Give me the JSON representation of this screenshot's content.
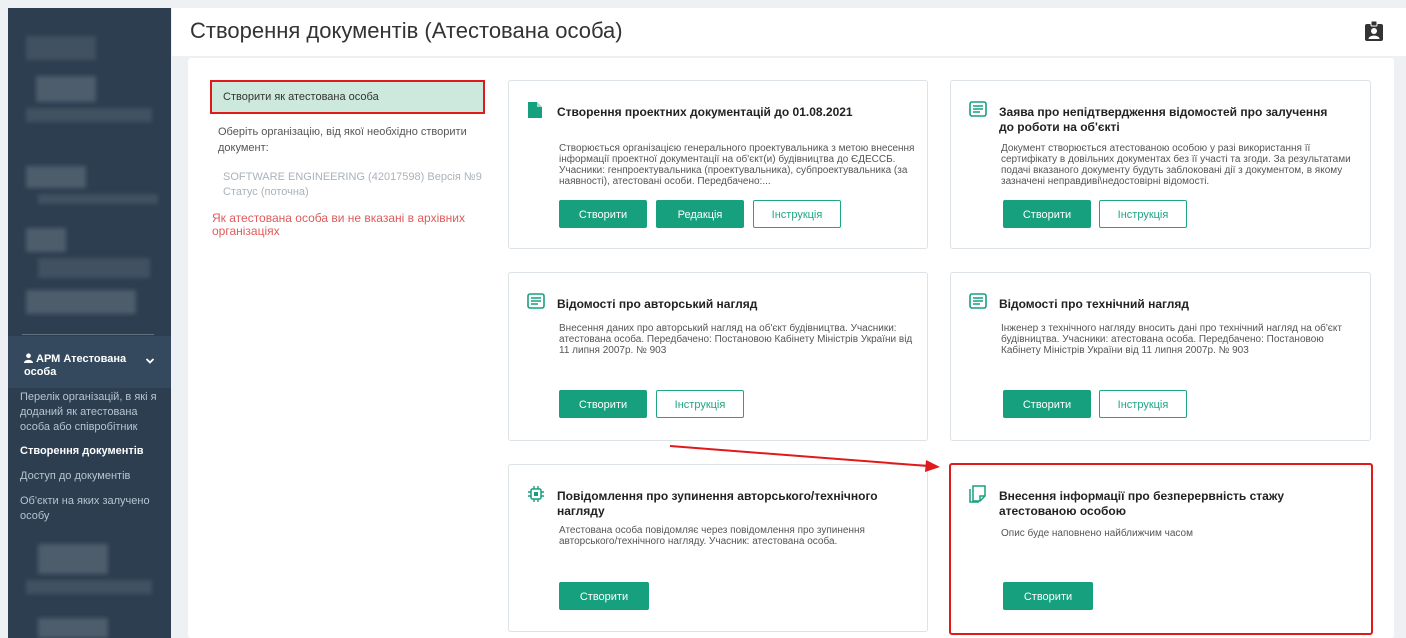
{
  "sidebar": {
    "arm": {
      "label": "АРМ Атестована особа"
    },
    "links": [
      {
        "label": "Перелік організацій, в які я доданий як атестована особа або співробітник",
        "active": false
      },
      {
        "label": "Створення документів",
        "active": true
      },
      {
        "label": "Доступ до документів",
        "active": false
      },
      {
        "label": "Об'єкти на яких залучено особу",
        "active": false
      }
    ]
  },
  "header": {
    "title": "Створення документів (Атестована особа)"
  },
  "left": {
    "create_as": "Створити як атестована особа",
    "choose": "Оберіть організацію, від якої необхідно створити документ:",
    "org_line1": "SOFTWARE ENGINEERING (42017598) Версія №9",
    "org_line2": "Статус (поточна)",
    "warning": "Як атестована особа ви не вказані в архівних організаціях"
  },
  "cards": [
    {
      "title": "Створення проектних документацій до 01.08.2021",
      "desc": "Створюється організацією генерального проектувальника з метою внесення інформації проектної документації на об'єкт(и) будівництва до ЄДЕССБ. Учасники: генпроектувальника (проектувальника), субпроектувальника (за наявності), атестовані особи. Передбачено:...",
      "buttons": [
        "Створити",
        "Редакція",
        "Інструкція"
      ]
    },
    {
      "title": "Заява про непідтвердження відомостей про залучення до роботи на об'єкті",
      "desc": "Документ створюється атестованою особою у разі використання її сертифікату в довільних документах без її участі та згоди. За результатами подачі вказаного документу будуть заблоковані дії з документом, в якому зазначені неправдиві\\недостовірні відомості.",
      "buttons": [
        "Створити",
        "Інструкція"
      ]
    },
    {
      "title": "Відомості про авторський нагляд",
      "desc": "Внесення даних про авторський нагляд на об'єкт будівництва. Учасники: атестована особа. Передбачено: Постановою Кабінету Міністрів України від 11 липня 2007р. № 903",
      "buttons": [
        "Створити",
        "Інструкція"
      ]
    },
    {
      "title": "Відомості про технічний нагляд",
      "desc": "Інженер з технічного нагляду вносить дані про технічний нагляд на об'єкт будівництва. Учасники: атестована особа. Передбачено: Постановою Кабінету Міністрів України від 11 липня 2007р. № 903",
      "buttons": [
        "Створити",
        "Інструкція"
      ]
    },
    {
      "title": "Повідомлення про зупинення авторського/технічного нагляду",
      "desc": "Атестована особа повідомляє через повідомлення про зупинення авторського/технічного нагляду. Учасник: атестована особа.",
      "buttons": [
        "Створити"
      ]
    },
    {
      "title": "Внесення інформації про безперервність стажу атестованою особою",
      "desc": "Опис буде наповнено найближчим часом",
      "buttons": [
        "Створити"
      ]
    }
  ],
  "colors": {
    "sidebar": "#2c3e50",
    "accent": "#16a07e",
    "highlight": "#e0191a",
    "warning": "#e05a5a"
  },
  "icons": [
    "user-icon",
    "chevron-down-icon",
    "id-badge-icon",
    "file-icon",
    "list-icon",
    "chip-icon",
    "copy-icon"
  ]
}
